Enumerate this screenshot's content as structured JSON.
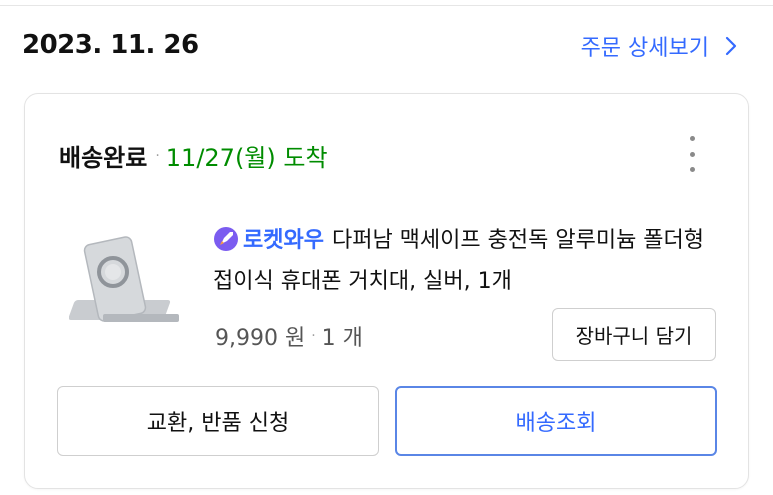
{
  "order": {
    "date": "2023. 11. 26",
    "detail_link": "주문 상세보기"
  },
  "shipment": {
    "status": "배송완료",
    "separator": "·",
    "arrival": "11/27(월) 도착"
  },
  "product": {
    "badge": "로켓와우",
    "name": "다퍼남 맥세이프 충전독 알루미늄 폴더형 접이식 휴대폰 거치대, 실버, 1개",
    "price": "9,990 원",
    "quantity": "1 개",
    "cart_button": "장바구니 담기"
  },
  "actions": {
    "return_exchange": "교환, 반품 신청",
    "track": "배송조회"
  },
  "colors": {
    "accent_blue": "#346aff",
    "arrival_green": "#008c00"
  },
  "icons": {
    "chevron": "chevron-right-icon",
    "more": "more-vertical-icon",
    "rocket": "rocket-wow-icon"
  }
}
